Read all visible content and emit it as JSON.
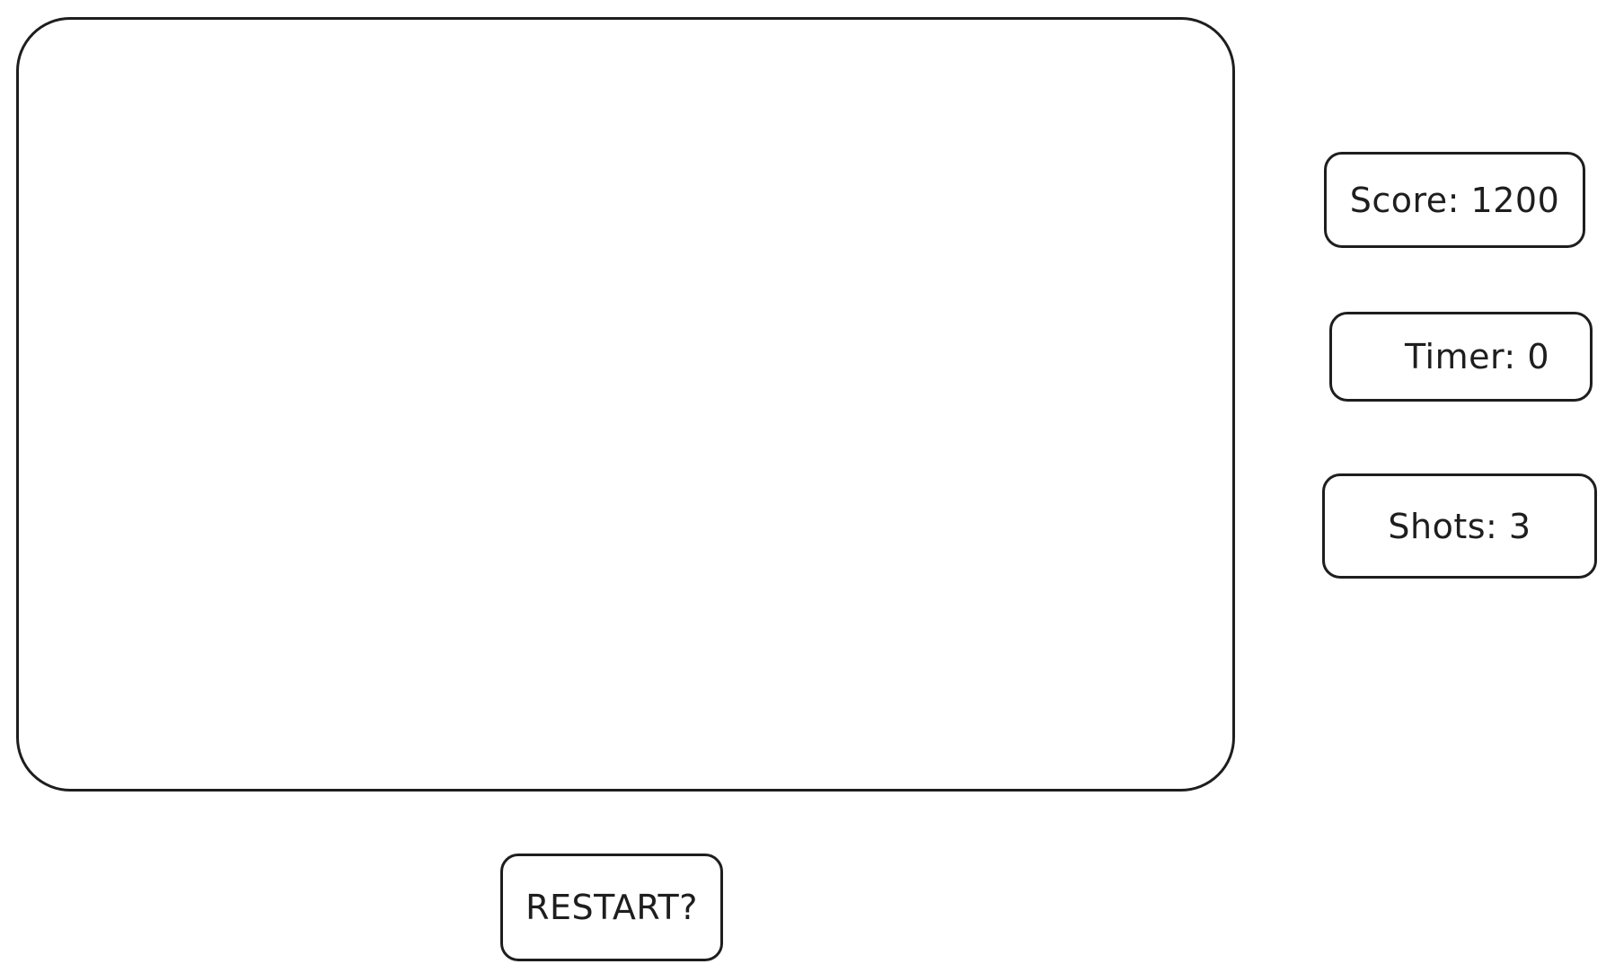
{
  "hud": {
    "score_text": "Score: 1200",
    "timer_text": "Timer: 0",
    "shots_text": "Shots: 3"
  },
  "controls": {
    "restart_label": "RESTART?"
  },
  "colors": {
    "stroke": "#1e1e1e",
    "background": "#ffffff"
  }
}
